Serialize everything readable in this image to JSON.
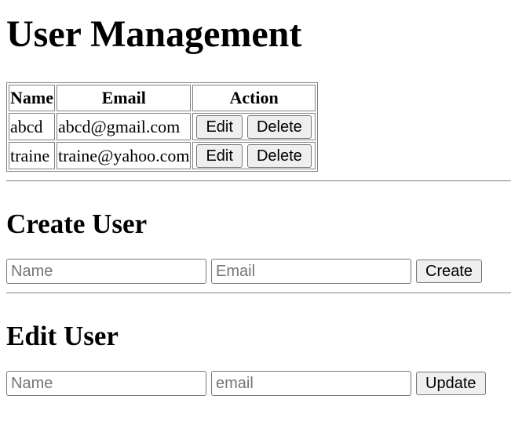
{
  "page": {
    "title": "User Management"
  },
  "users_table": {
    "headers": [
      "Name",
      "Email",
      "Action"
    ],
    "rows": [
      {
        "name": "abcd",
        "email": "abcd@gmail.com",
        "edit_label": "Edit",
        "delete_label": "Delete"
      },
      {
        "name": "traine",
        "email": "traine@yahoo.com",
        "edit_label": "Edit",
        "delete_label": "Delete"
      }
    ]
  },
  "create_user": {
    "heading": "Create User",
    "name_placeholder": "Name",
    "email_placeholder": "Email",
    "button_label": "Create"
  },
  "edit_user": {
    "heading": "Edit User",
    "name_placeholder": "Name",
    "email_placeholder": "email",
    "button_label": "Update"
  }
}
